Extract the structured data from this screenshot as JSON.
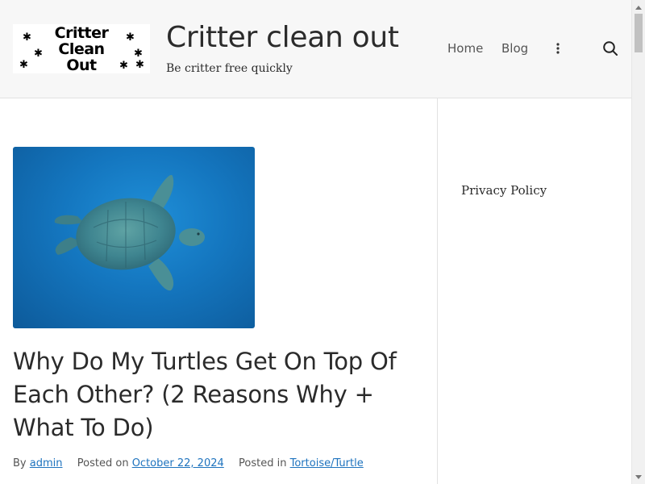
{
  "header": {
    "logo": {
      "lines": [
        "Critter",
        "Clean",
        "Out"
      ]
    },
    "title": "Critter clean out",
    "tagline": "Be critter free quickly",
    "nav": [
      {
        "label": "Home"
      },
      {
        "label": "Blog"
      }
    ],
    "more_icon": "vertical-ellipsis-icon",
    "search_icon": "search-icon"
  },
  "post": {
    "image_icon": "sea-turtle-photo",
    "title": "Why Do My Turtles Get On Top Of Each Other? (2 Reasons Why + What To Do)",
    "meta": {
      "by_label": "By",
      "author": "admin",
      "posted_on_label": "Posted on",
      "date": "October 22, 2024",
      "posted_in_label": "Posted in",
      "category": "Tortoise/Turtle"
    }
  },
  "sidebar": {
    "links": [
      {
        "label": "Privacy Policy"
      }
    ]
  },
  "colors": {
    "header_bg": "#f7f7f7",
    "link": "#1e73be",
    "text": "#2b2b2b",
    "water": "#1476bf"
  }
}
